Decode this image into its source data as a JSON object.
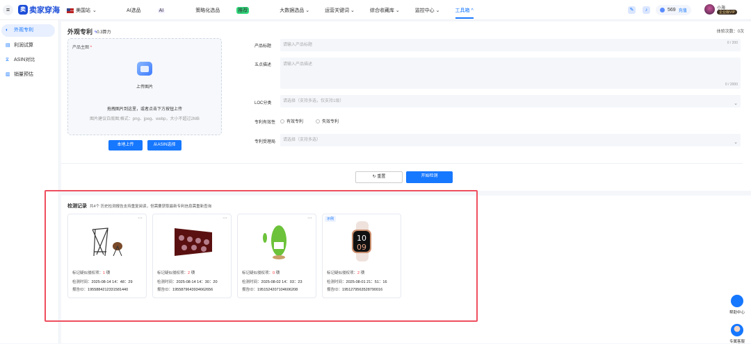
{
  "header": {
    "logo": "卖家穿海",
    "site": "美国站",
    "nav": [
      {
        "label": "AI选品",
        "badge": "AI"
      },
      {
        "label": "策略化选品",
        "badge": "推荐"
      },
      {
        "label": "大数据选品 ⌄"
      },
      {
        "label": "运营关键词 ⌄"
      },
      {
        "label": "综合收藏库 ⌄"
      },
      {
        "label": "监控中心 ⌄"
      },
      {
        "label": "工具箱 ^",
        "active": true
      }
    ],
    "points": "569",
    "recharge": "充值",
    "username": "小海",
    "vip": "企业版VIP"
  },
  "sidebar": {
    "items": [
      {
        "label": "外观专利",
        "icon": "patent-icon"
      },
      {
        "label": "利润试算",
        "icon": "calculator-icon"
      },
      {
        "label": "ASIN对比",
        "icon": "compare-icon"
      },
      {
        "label": "销量预估",
        "icon": "chart-icon"
      }
    ]
  },
  "page": {
    "title": "外观专利",
    "power": "0.3算力",
    "trial": "体验次数：0次"
  },
  "upload": {
    "label": "产品主图",
    "required": "*",
    "button": "上传图片",
    "hint": "拖拽图片到这里，或者点击下方按钮上传",
    "format": "图片建议白底图;格式：png、jpeg、webp，大小不超过2MB",
    "local": "本地上传",
    "asin": "从ASIN选择"
  },
  "form": {
    "title_label": "产品标题",
    "title_ph": "请输入产品标题",
    "title_count": "0 / 200",
    "desc_label": "五点描述",
    "desc_ph": "请输入产品描述",
    "desc_count": "0 / 2000",
    "loc_label": "LOC分类",
    "loc_ph": "请选择（支持多选，仅支持1级）",
    "validity_label": "专利有效性",
    "valid": "有效专利",
    "invalid": "失效专利",
    "office_label": "专利受理局",
    "office_ph": "请选择（支持多选）",
    "reset": "重置",
    "start": "开始检测"
  },
  "records": {
    "title": "检测记录",
    "subtitle": "共4个 历史检测报告支持重复阅读，但需要获取最新专利信息需重新查询",
    "risk_label": "标记疑似侵权项：",
    "time_label": "检测时间：",
    "id_label": "报告ID：",
    "unit": "项",
    "sample": "示例",
    "items": [
      {
        "risk": "1",
        "time": "2025-08-14 14：48：29",
        "id": "1955884212331581440",
        "img": "rack"
      },
      {
        "risk": "2",
        "time": "2025-08-14 14：30：20",
        "id": "1955879643934662656",
        "img": "poster"
      },
      {
        "risk": "0",
        "time": "2025-08-02 14：03：23",
        "id": "1951524207104606208",
        "img": "pickle"
      },
      {
        "risk": "2",
        "time": "2025-08-01 21：51：16",
        "id": "1951279563528790016",
        "img": "watch",
        "sample": true
      }
    ]
  },
  "float": {
    "help": "帮助中心",
    "service": "专属客服"
  },
  "colors": {
    "primary": "#1677ff",
    "highlight": "#ef4d5e",
    "risk": "#ff3333"
  }
}
